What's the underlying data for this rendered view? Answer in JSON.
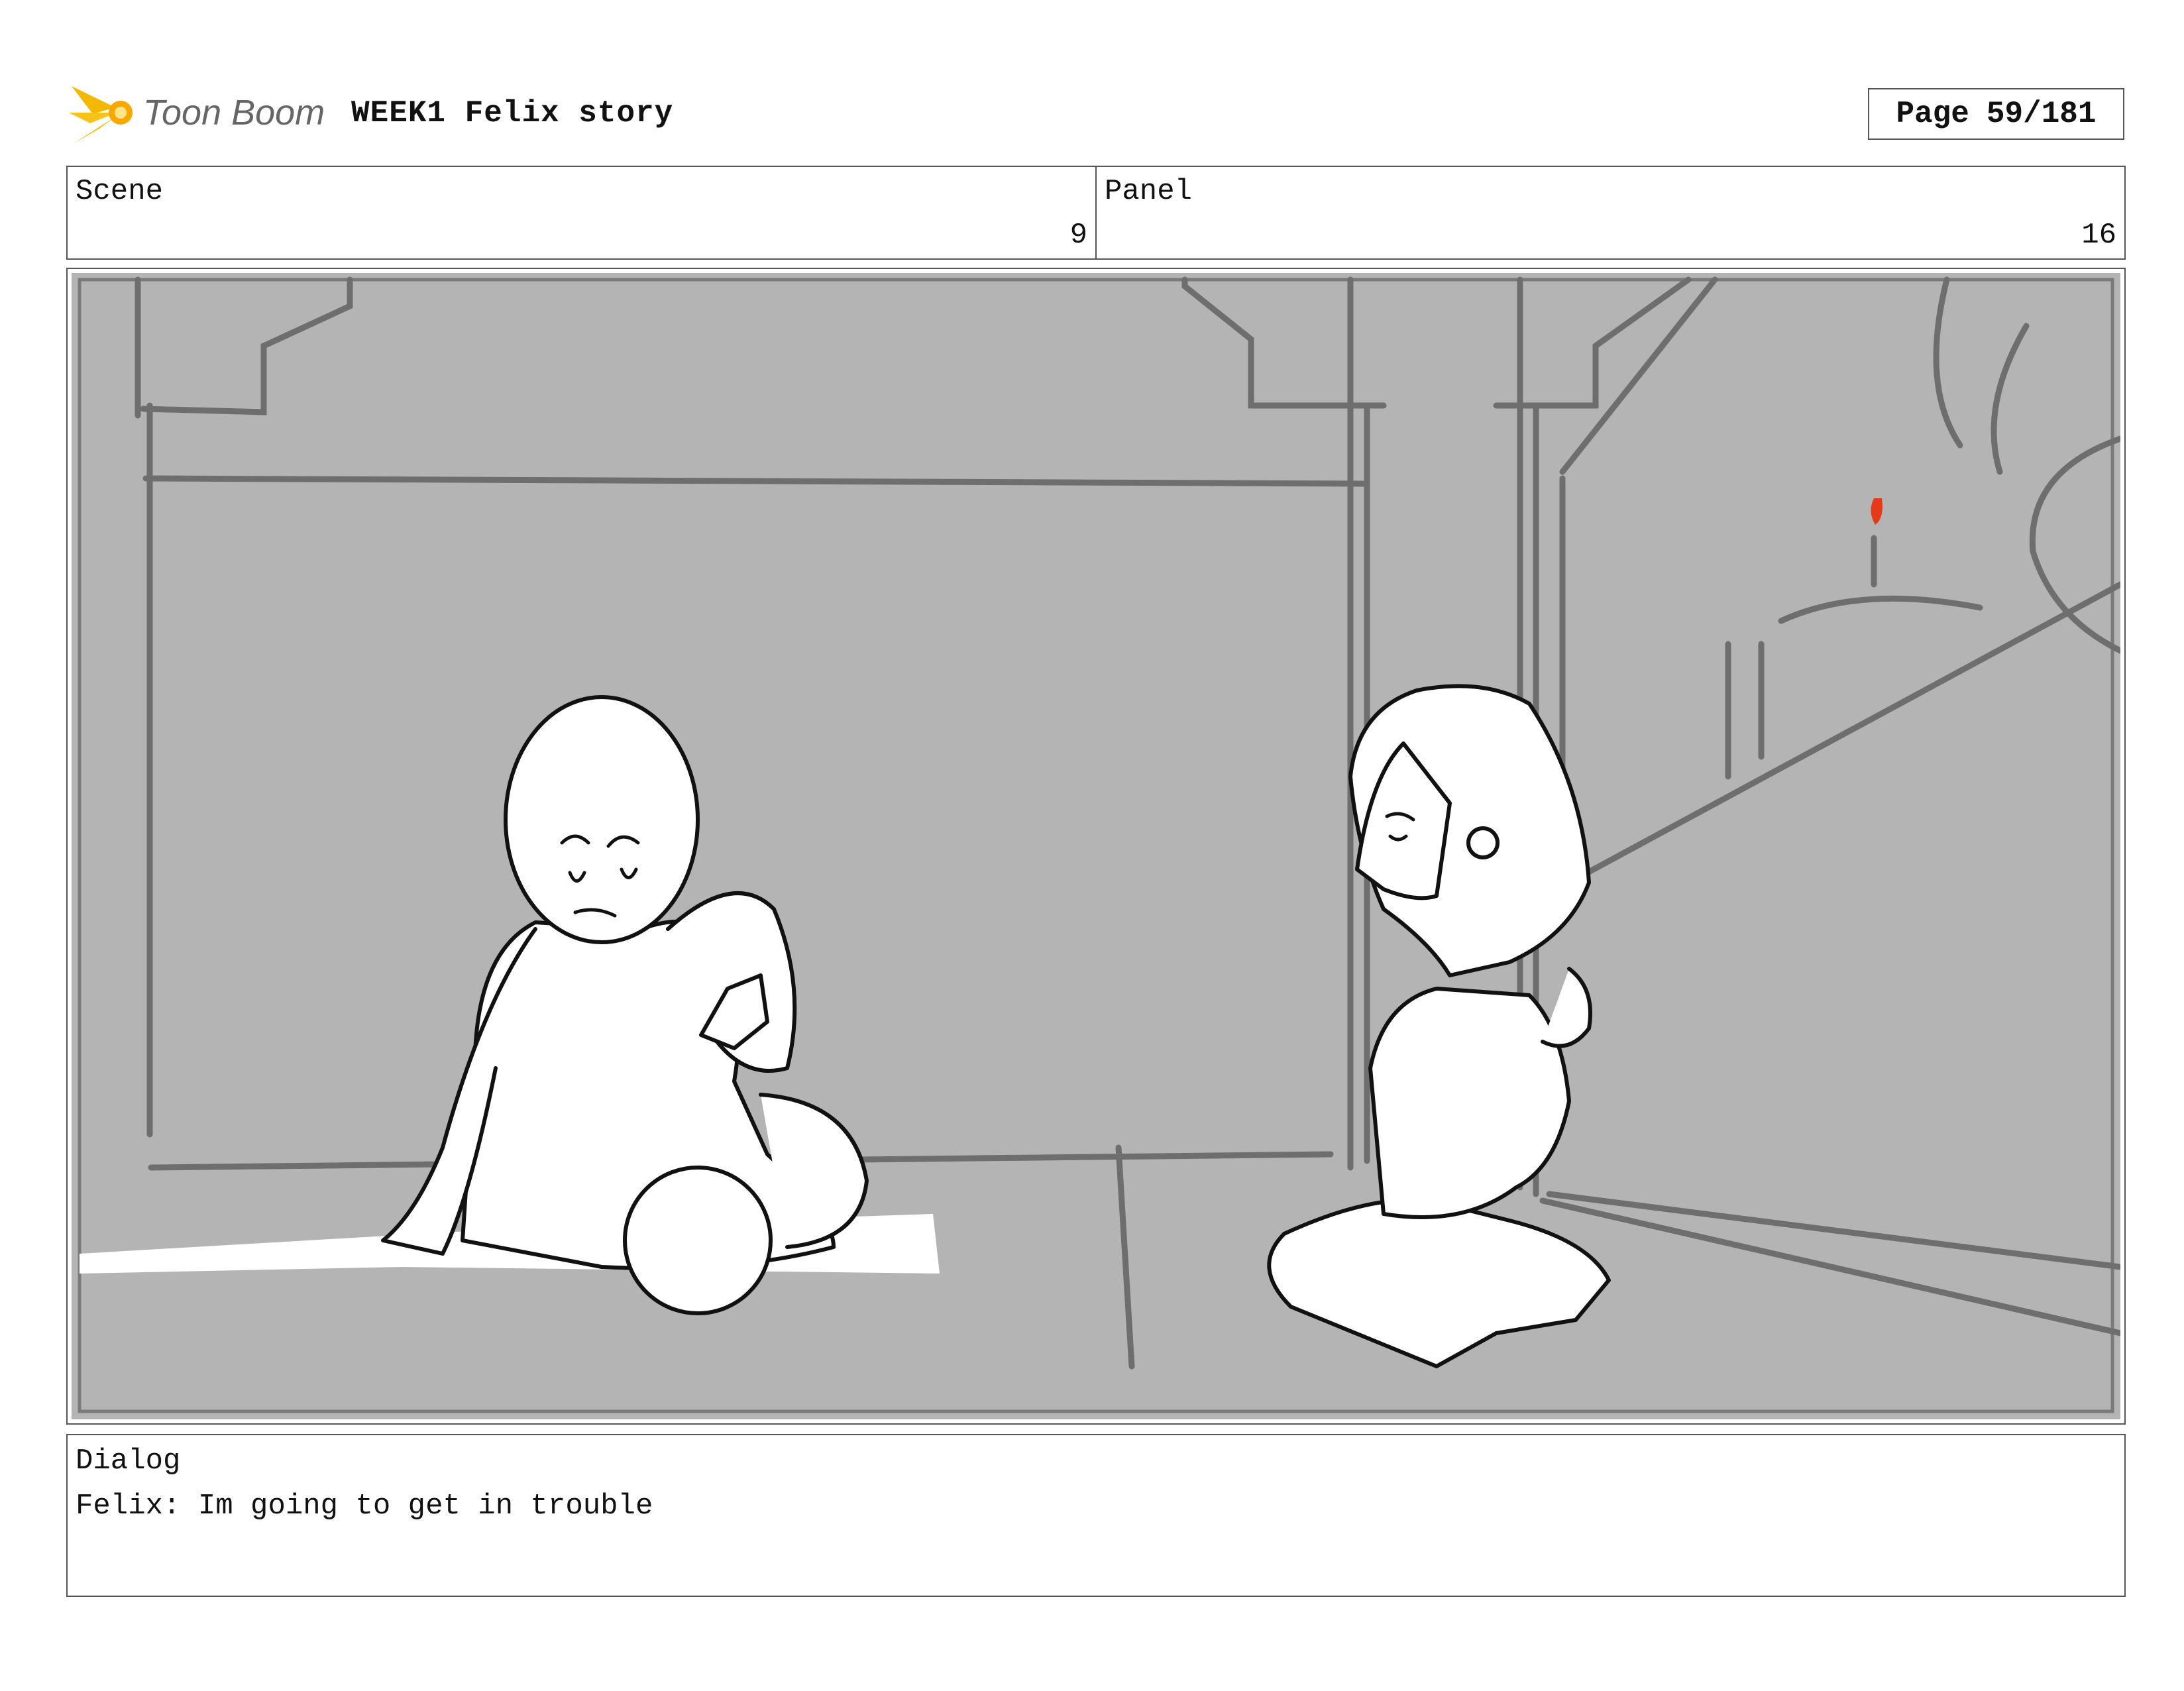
{
  "header": {
    "logo_text": "Toon Boom",
    "title": "WEEK1 Felix story",
    "page_label": "Page",
    "page_value": "59/181"
  },
  "scene": {
    "label": "Scene",
    "value": "9"
  },
  "panel": {
    "label": "Panel",
    "value": "16"
  },
  "dialog": {
    "label": "Dialog",
    "text": "Felix: Im going to get in trouble"
  },
  "colors": {
    "logo_burst": "#f5b800",
    "logo_text": "#666666",
    "sketch_background": "#b4b4b4",
    "sketch_lines": "#6e6e6e",
    "candle_flame": "#e53a1a"
  },
  "icons": [
    "toon-boom-logo",
    "storyboard-sketch"
  ]
}
